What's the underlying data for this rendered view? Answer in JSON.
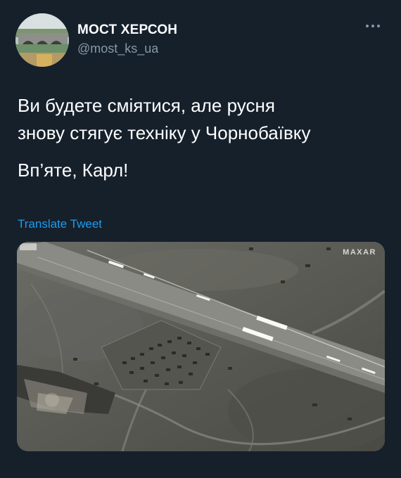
{
  "tweet": {
    "author": {
      "display_name": "МОСТ ХЕРСОН",
      "handle": "@most_ks_ua"
    },
    "text_lines": [
      "Ви будете сміятися, але русня",
      "знову стягує техніку у Чорнобаївку"
    ],
    "text_line_2": "Вп’яте, Карл!",
    "translate_label": "Translate Tweet",
    "media": {
      "watermark": "MAXAR"
    }
  },
  "icons": {
    "more": "more-horizontal-icon"
  },
  "colors": {
    "background": "#15202b",
    "text": "#ffffff",
    "secondary_text": "#8899a6",
    "link": "#1d9bf0"
  }
}
